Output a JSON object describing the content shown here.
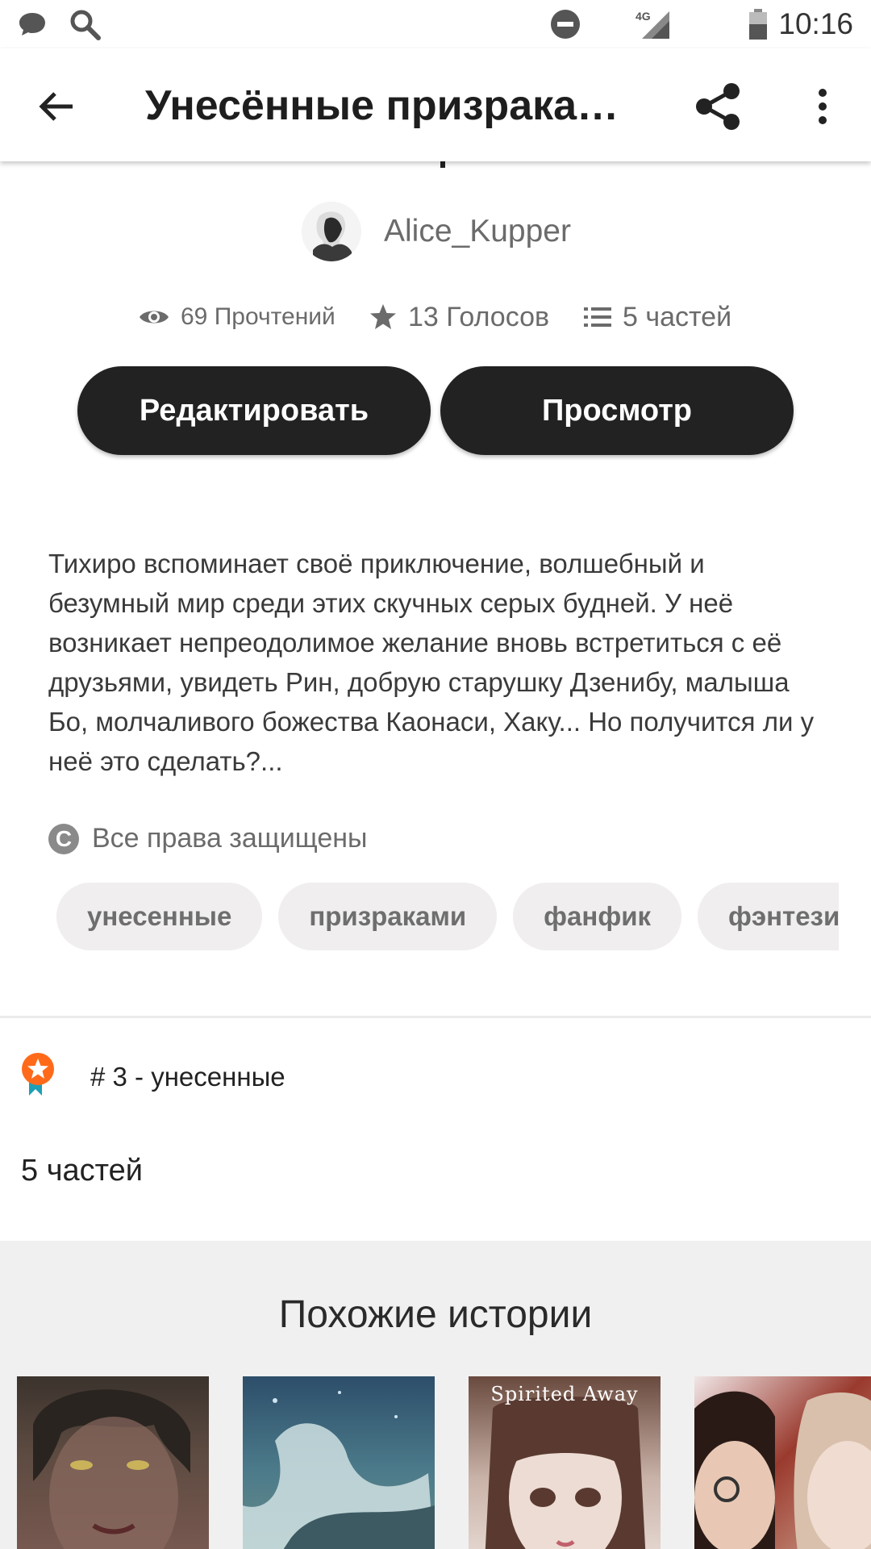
{
  "status_bar": {
    "time": "10:16",
    "network": "4G",
    "icons": [
      "chat-bubble-icon",
      "search-icon",
      "do-not-disturb-icon",
      "signal-icon",
      "battery-icon"
    ]
  },
  "app_bar": {
    "title": "Унесённые призраками....",
    "icons": [
      "arrow-back-icon",
      "share-icon",
      "more-vert-icon"
    ]
  },
  "author": {
    "name": "Alice_Kupper"
  },
  "stats": {
    "reads": "69 Прочтений",
    "votes": "13 Голосов",
    "parts": "5 частей"
  },
  "actions": {
    "edit_label": "Редактировать",
    "preview_label": "Просмотр"
  },
  "description": "Тихиро вспоминает своё приключение, волшебный и безумный мир среди этих скучных серых будней. У неё возникает непреодолимое желание вновь встретиться с её друзьями, увидеть Рин, добрую старушку Дзенибу, малыша Бо, молчаливого божества Каонаси, Хаку... Но получится ли у неё это сделать?...",
  "copyright": {
    "symbol": "C",
    "text": "Все права защищены"
  },
  "tags": [
    "унесенные",
    "призраками",
    "фанфик",
    "фэнтези"
  ],
  "ranking": {
    "text": "# 3 - унесенные"
  },
  "parts_count": "5 частей",
  "similar": {
    "title": "Похожие истории",
    "cover_label": "Spirited Away"
  },
  "colors": {
    "button_bg": "#222222",
    "tag_bg": "#f0eeee",
    "rank_badge": "#ff6a1a",
    "rank_ribbon": "#1e9fb5",
    "similar_bg": "#f0f0f0"
  }
}
